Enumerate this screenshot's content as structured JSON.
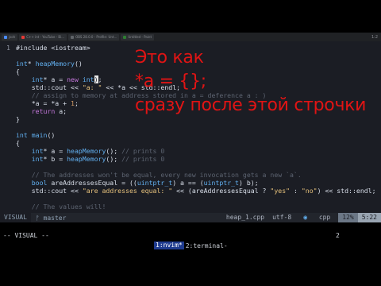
{
  "taskbar": {
    "tabs": [
      {
        "label": "jsoh",
        "color": "#4a8cff"
      },
      {
        "label": "C++ int - YouTube - Bi...",
        "color": "#e53935"
      },
      {
        "label": "OBS 28.0.0 - Profile: Unt...",
        "color": "#5f6368"
      },
      {
        "label": "Untitled - Paint",
        "color": "#2e7d32"
      }
    ],
    "right_text": "1:2"
  },
  "editor": {
    "lines": [
      {
        "num": "1",
        "html_parts": [
          {
            "t": "#include <iostream>",
            "c": ""
          }
        ]
      },
      {
        "num": "",
        "html_parts": []
      },
      {
        "num": "",
        "html_parts": [
          {
            "t": "int",
            "c": "ty"
          },
          {
            "t": "* ",
            "c": ""
          },
          {
            "t": "heapMemory",
            "c": "fn"
          },
          {
            "t": "()",
            "c": ""
          }
        ]
      },
      {
        "num": "",
        "html_parts": [
          {
            "t": "{",
            "c": ""
          }
        ]
      },
      {
        "num": "",
        "html_parts": [
          {
            "t": "    ",
            "c": ""
          },
          {
            "t": "int",
            "c": "ty"
          },
          {
            "t": "* a = ",
            "c": ""
          },
          {
            "t": "new",
            "c": "kw"
          },
          {
            "t": " ",
            "c": ""
          },
          {
            "t": "int",
            "c": "ty"
          },
          {
            "t": ")",
            "c": "cursor"
          },
          {
            "t": ";",
            "c": ""
          }
        ]
      },
      {
        "num": "",
        "html_parts": [
          {
            "t": "    std::cout << ",
            "c": ""
          },
          {
            "t": "\"a: \"",
            "c": "st"
          },
          {
            "t": " << *a << std::endl;",
            "c": ""
          }
        ]
      },
      {
        "num": "",
        "html_parts": [
          {
            "t": "    // assign to memory at address stored in a = deference a : )",
            "c": "cm"
          }
        ]
      },
      {
        "num": "",
        "html_parts": [
          {
            "t": "    *a = *a + ",
            "c": ""
          },
          {
            "t": "1",
            "c": "nm"
          },
          {
            "t": ";",
            "c": ""
          }
        ]
      },
      {
        "num": "",
        "html_parts": [
          {
            "t": "    ",
            "c": ""
          },
          {
            "t": "return",
            "c": "kw"
          },
          {
            "t": " a;",
            "c": ""
          }
        ]
      },
      {
        "num": "",
        "html_parts": [
          {
            "t": "}",
            "c": ""
          }
        ]
      },
      {
        "num": "",
        "html_parts": []
      },
      {
        "num": "",
        "html_parts": [
          {
            "t": "int",
            "c": "ty"
          },
          {
            "t": " ",
            "c": ""
          },
          {
            "t": "main",
            "c": "fn"
          },
          {
            "t": "()",
            "c": ""
          }
        ]
      },
      {
        "num": "",
        "html_parts": [
          {
            "t": "{",
            "c": ""
          }
        ]
      },
      {
        "num": "",
        "html_parts": [
          {
            "t": "    ",
            "c": ""
          },
          {
            "t": "int",
            "c": "ty"
          },
          {
            "t": "* a = ",
            "c": ""
          },
          {
            "t": "heapMemory",
            "c": "fn"
          },
          {
            "t": "(); ",
            "c": ""
          },
          {
            "t": "// prints 0",
            "c": "cm"
          }
        ]
      },
      {
        "num": "",
        "html_parts": [
          {
            "t": "    ",
            "c": ""
          },
          {
            "t": "int",
            "c": "ty"
          },
          {
            "t": "* b = ",
            "c": ""
          },
          {
            "t": "heapMemory",
            "c": "fn"
          },
          {
            "t": "(); ",
            "c": ""
          },
          {
            "t": "// prints 0",
            "c": "cm"
          }
        ]
      },
      {
        "num": "",
        "html_parts": []
      },
      {
        "num": "",
        "html_parts": [
          {
            "t": "    // The addresses won't be equal, every new invocation gets a new `a`.",
            "c": "cm"
          }
        ]
      },
      {
        "num": "",
        "html_parts": [
          {
            "t": "    ",
            "c": ""
          },
          {
            "t": "bool",
            "c": "ty"
          },
          {
            "t": " areAddressesEqual = ((",
            "c": ""
          },
          {
            "t": "uintptr_t",
            "c": "ty"
          },
          {
            "t": ") a == (",
            "c": ""
          },
          {
            "t": "uintptr_t",
            "c": "ty"
          },
          {
            "t": ") b);",
            "c": ""
          }
        ]
      },
      {
        "num": "",
        "html_parts": [
          {
            "t": "    std::cout << ",
            "c": ""
          },
          {
            "t": "\"are addresses equal: \"",
            "c": "st"
          },
          {
            "t": " << (areAddressesEqual ? ",
            "c": ""
          },
          {
            "t": "\"yes\"",
            "c": "st"
          },
          {
            "t": " : ",
            "c": ""
          },
          {
            "t": "\"no\"",
            "c": "st"
          },
          {
            "t": ") << std::endl;",
            "c": ""
          }
        ]
      },
      {
        "num": "",
        "html_parts": []
      },
      {
        "num": "",
        "html_parts": [
          {
            "t": "    // The values will!",
            "c": "cm"
          }
        ]
      }
    ]
  },
  "overlay": {
    "line1": "Это как",
    "line2": "*a = {};",
    "line3": "сразу после этой строчки"
  },
  "statusline": {
    "mode": "VISUAL",
    "branch_icon": "git-branch-icon",
    "branch": "master",
    "file": "heap_1.cpp",
    "encoding": "utf-8",
    "filetype_icon": "cpp-icon",
    "filetype": "cpp",
    "percent": "12%",
    "position": "5:22"
  },
  "message": {
    "text": "-- VISUAL --",
    "count": "2"
  },
  "tmux": {
    "window1": "1:nvim*",
    "window2": "2:terminal-"
  }
}
